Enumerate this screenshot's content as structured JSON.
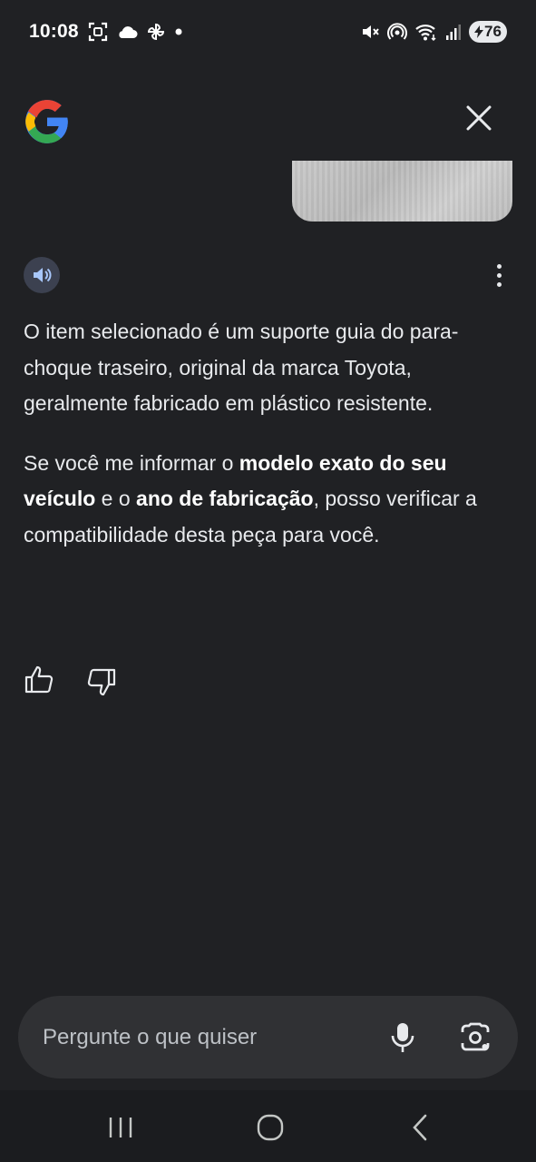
{
  "status_bar": {
    "time": "10:08",
    "battery": "76",
    "icons_left": [
      "screenshot-icon",
      "cloud-icon",
      "pinwheel-icon",
      "dot-icon"
    ],
    "icons_right": [
      "mute-icon",
      "hotspot-icon",
      "wifi-icon",
      "signal-icon"
    ]
  },
  "header": {
    "logo": "google-g-logo",
    "close_icon": "close-icon"
  },
  "response": {
    "paragraph1": "O item selecionado é um suporte guia do para-choque traseiro, original da marca Toyota, geralmente fabricado em plástico resistente.",
    "p2_part1": "Se você me informar o ",
    "p2_bold1": "modelo exato do seu veículo",
    "p2_part2": " e o ",
    "p2_bold2": "ano de fabricação",
    "p2_part3": ", posso verificar a compatibilidade desta peça para você."
  },
  "input": {
    "placeholder": "Pergunte o que quiser"
  },
  "colors": {
    "background": "#202124",
    "input_bar": "#303134",
    "speaker_button": "#3c4150",
    "nav_bar": "#1b1c1f"
  }
}
